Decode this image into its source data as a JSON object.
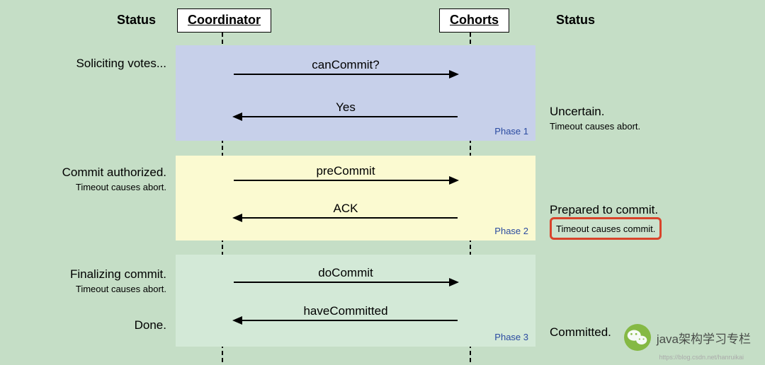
{
  "headers": {
    "status_left": "Status",
    "coordinator": "Coordinator",
    "cohorts": "Cohorts",
    "status_right": "Status"
  },
  "phases": [
    {
      "label": "Phase 1",
      "messages": [
        {
          "text": "canCommit?",
          "dir": "right"
        },
        {
          "text": "Yes",
          "dir": "left"
        }
      ]
    },
    {
      "label": "Phase 2",
      "messages": [
        {
          "text": "preCommit",
          "dir": "right"
        },
        {
          "text": "ACK",
          "dir": "left"
        }
      ]
    },
    {
      "label": "Phase 3",
      "messages": [
        {
          "text": "doCommit",
          "dir": "right"
        },
        {
          "text": "haveCommitted",
          "dir": "left"
        }
      ]
    }
  ],
  "status_left": {
    "p1": {
      "main": "Soliciting votes..."
    },
    "p2": {
      "main": "Commit authorized.",
      "sub": "Timeout causes abort."
    },
    "p3a": {
      "main": "Finalizing commit.",
      "sub": "Timeout causes abort."
    },
    "p3b": {
      "main": "Done."
    }
  },
  "status_right": {
    "p1": {
      "main": "Uncertain.",
      "sub": "Timeout causes abort."
    },
    "p2": {
      "main": "Prepared to commit.",
      "sub": "Timeout causes commit."
    },
    "p3": {
      "main": "Committed."
    }
  },
  "watermark": {
    "icon_name": "wechat-icon",
    "text": "java架构学习专栏",
    "faint": "https://blog.csdn.net/hanruikai"
  }
}
